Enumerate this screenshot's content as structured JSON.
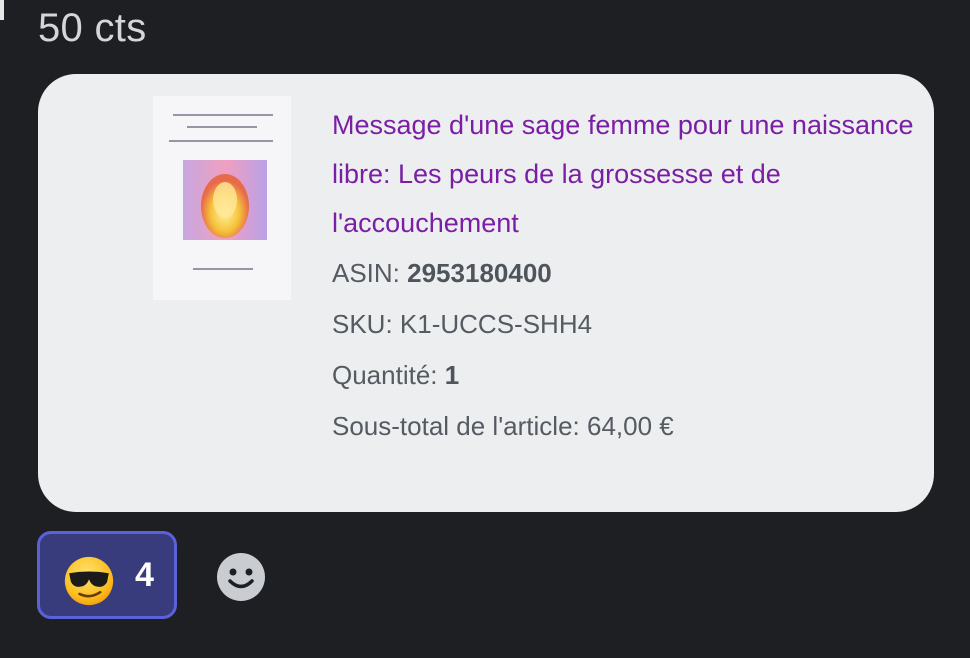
{
  "message": {
    "text": "50 cts"
  },
  "product": {
    "title": "Message d'une sage femme pour une naissance libre: Les peurs de la grossesse et de l'accouchement",
    "asin_label": "ASIN: ",
    "asin_value": "2953180400",
    "sku_label": "SKU: ",
    "sku_value": "K1-UCCS-SHH4",
    "quantity_label": "Quantité: ",
    "quantity_value": "1",
    "subtotal_label": "Sous-total de l'article: ",
    "subtotal_value": "64,00 €",
    "thumbnail": "book-cover-image"
  },
  "reactions": [
    {
      "emoji": "smiling-face-with-sunglasses",
      "count": "4",
      "selected": true
    }
  ],
  "colors": {
    "background": "#1e1f22",
    "card": "#edeeef",
    "title": "#7a1fa5",
    "reaction_border": "#5a61d9",
    "reaction_bg": "#383c7c"
  }
}
